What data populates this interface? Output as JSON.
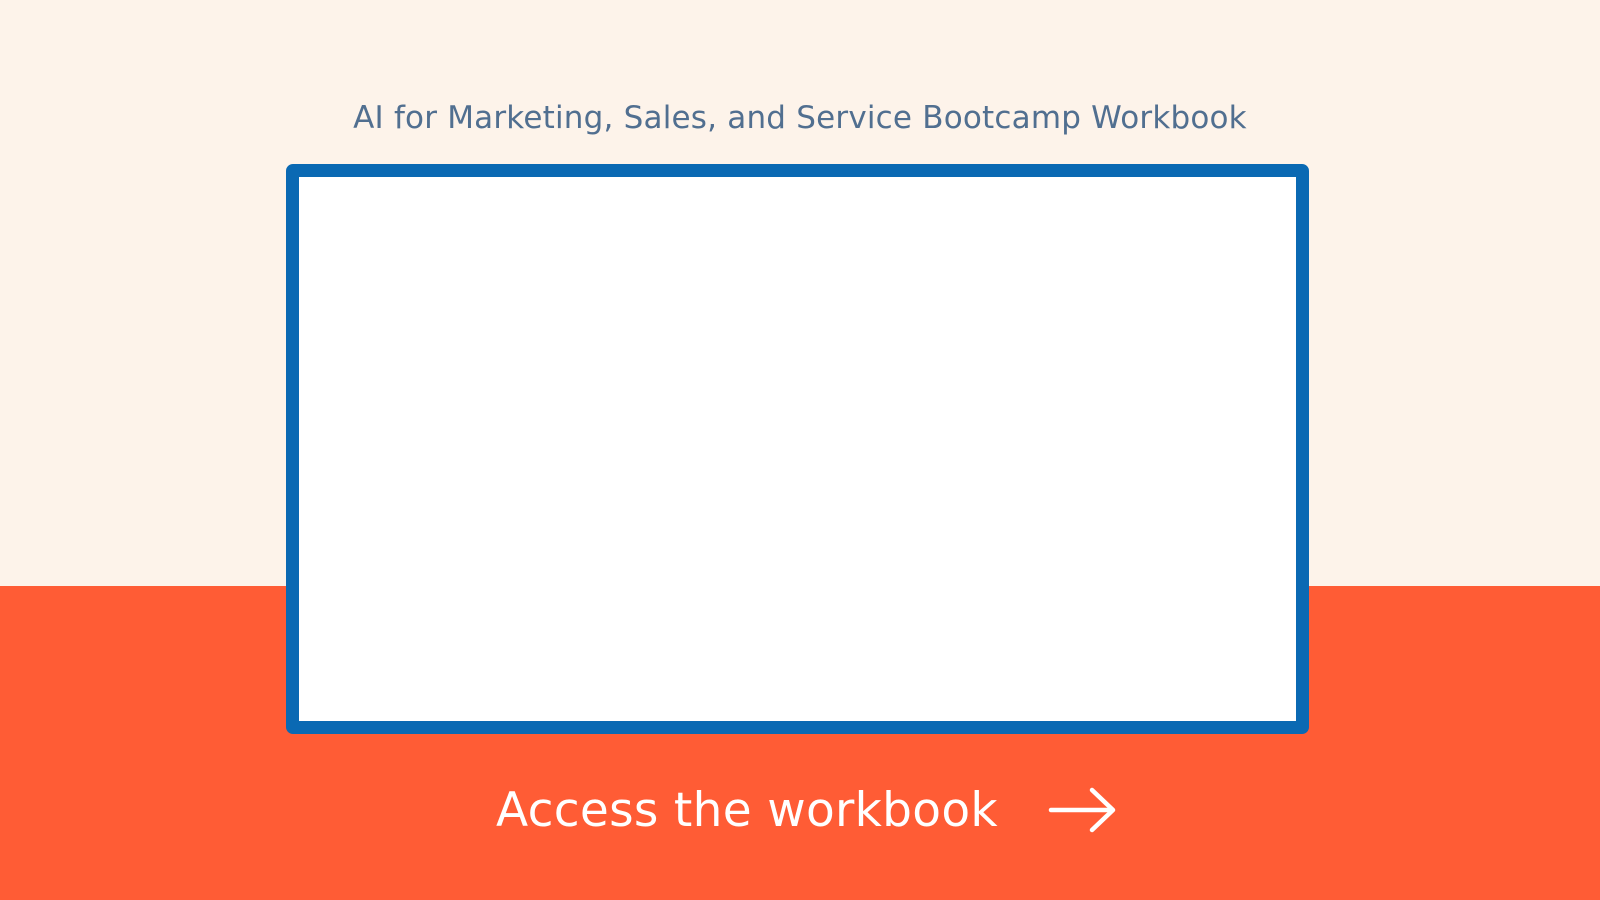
{
  "page": {
    "title": "AI for Marketing, Sales, and Service Bootcamp Workbook",
    "background_top": "#FDF3EA",
    "background_bottom": "#FF5C35"
  },
  "preview": {
    "border_color": "#0A69B3",
    "fill_color": "#FFFFFF"
  },
  "cta": {
    "label": "Access the workbook",
    "icon": "arrow-right-icon"
  }
}
